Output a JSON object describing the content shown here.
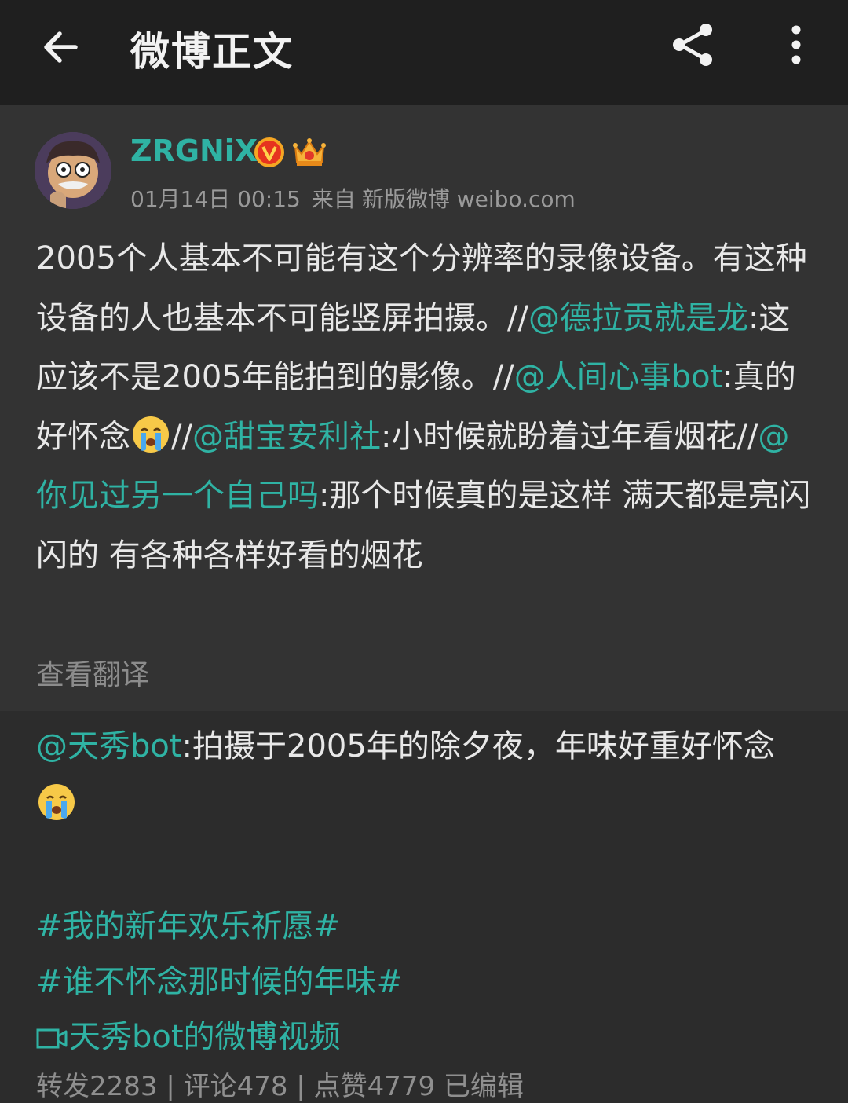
{
  "header": {
    "title": "微博正文"
  },
  "repost": {
    "user": {
      "name": "ZRGNiX"
    },
    "meta": {
      "time": "01月14日 00:15",
      "source_prefix": "来自",
      "source": "新版微博 weibo.com"
    },
    "text": {
      "p1": "2005个人基本不可能有这个分辨率的录像设备。有这种设备的人也基本不可能竖屏拍摄。//",
      "m1": "@德拉贡就是龙",
      "p2": ":这应该不是2005年能拍到的影像。//",
      "m2": "@人间心事bot",
      "p3": ":真的好怀念",
      "p4": "//",
      "m3": "@甜宝安利社",
      "p5": ":小时候就盼着过年看烟花//",
      "m4": "@你见过另一个自己吗",
      "p6": ":那个时候真的是这样 满天都是亮闪闪的 有各种各样好看的烟花"
    },
    "translate_label": "查看翻译"
  },
  "original": {
    "mention": "@天秀bot",
    "text": ":拍摄于2005年的除夕夜，年味好重好怀念",
    "topics": [
      "#我的新年欢乐祈愿#",
      "#谁不怀念那时候的年味#"
    ],
    "video_link": "天秀bot的微博视频",
    "stats": "转发2283 | 评论478 | 点赞4779  已编辑"
  },
  "colors": {
    "accent": "#2fb3a4",
    "background": "#2c2c2c",
    "repost_background": "#333333",
    "header_background": "#1f1f1f"
  },
  "icons": [
    "back-arrow-icon",
    "share-icon",
    "more-vertical-icon",
    "verified-icon",
    "crown-icon",
    "crying-emoji-icon",
    "video-icon"
  ]
}
